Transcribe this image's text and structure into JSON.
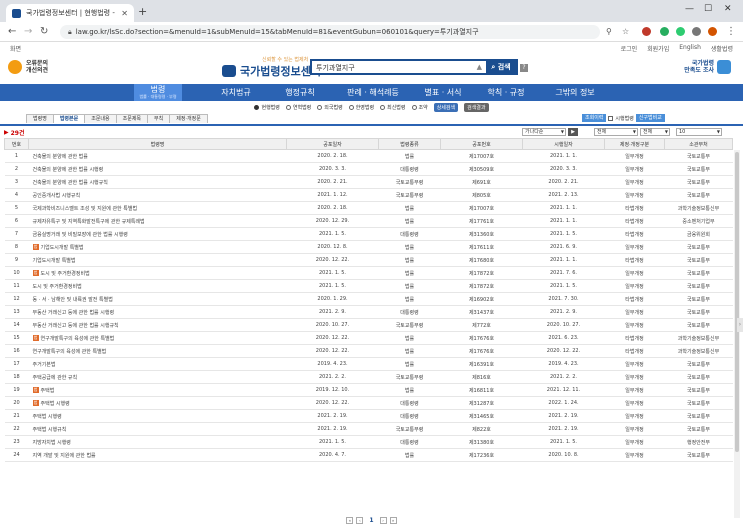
{
  "browser": {
    "tab_title": "국가법령정보센터 | 현행법령 -",
    "url": "law.go.kr/lsSc.do?section=&menuId=1&subMenuId=15&tabMenuId=81&eventGubun=060101&query=투기과열지구"
  },
  "util": {
    "left": "화면",
    "links": [
      "로그인",
      "회원가입",
      "English",
      "생활법령"
    ]
  },
  "header": {
    "left_logo": [
      "오류문의",
      "개선의견"
    ],
    "slogan": "신뢰할 수 있는 법제처",
    "brand": "국가법령정보센터",
    "search_query": "투기과열지구",
    "search_button": "검색",
    "right_logo": [
      "국가법령",
      "만족도 조사"
    ]
  },
  "menu": {
    "active_label": "법령",
    "active_sub": "법률 · 대통령령 · 부령",
    "items": [
      "자치법규",
      "행정규칙",
      "판례 · 해석례등",
      "별표 · 서식",
      "학칙 · 규정",
      "그밖의 정보"
    ]
  },
  "options": {
    "radios": [
      "현행법령",
      "연혁법령",
      "외국법령",
      "한영법령",
      "최신법령",
      "조약"
    ],
    "buttons": [
      "상세검색",
      "검색결과"
    ]
  },
  "subtabs": [
    "법령명",
    "법령본문",
    "조문내용",
    "조문제목",
    "부칙",
    "제정·개정문"
  ],
  "tools": {
    "buttons": [
      "조회이력",
      "신구법비교"
    ],
    "checkbox": "시행법령"
  },
  "results": {
    "count": "29건",
    "selects": [
      "가나다순",
      "전체",
      "전체",
      "10"
    ]
  },
  "table": {
    "headers": [
      "번호",
      "법령명",
      "공포일자",
      "법령종류",
      "공포번호",
      "시행일자",
      "제정·개정구분",
      "소관부처"
    ],
    "rows": [
      {
        "no": "1",
        "name": "건축물의 분양에 관한 법률",
        "tag": "",
        "date": "2020. 2. 18.",
        "kind": "법률",
        "num": "제17007호",
        "eff": "2021. 1. 1.",
        "type": "일부개정",
        "dept": "국토교통부"
      },
      {
        "no": "2",
        "name": "건축물의 분양에 관한 법률 시행령",
        "tag": "",
        "date": "2020. 3. 3.",
        "kind": "대통령령",
        "num": "제30509호",
        "eff": "2020. 3. 3.",
        "type": "일부개정",
        "dept": "국토교통부"
      },
      {
        "no": "3",
        "name": "건축물의 분양에 관한 법률 시행규칙",
        "tag": "",
        "date": "2020. 2. 21.",
        "kind": "국토교통부령",
        "num": "제691호",
        "eff": "2020. 2. 21.",
        "type": "일부개정",
        "dept": "국토교통부"
      },
      {
        "no": "4",
        "name": "공인중개사법 시행규칙",
        "tag": "",
        "date": "2021. 1. 12.",
        "kind": "국토교통부령",
        "num": "제805호",
        "eff": "2021. 2. 13.",
        "type": "일부개정",
        "dept": "국토교통부"
      },
      {
        "no": "5",
        "name": "국제과학비즈니스벨트 조성 및 지원에 관한 특별법",
        "tag": "",
        "date": "2020. 2. 18.",
        "kind": "법률",
        "num": "제17007호",
        "eff": "2021. 1. 1.",
        "type": "타법개정",
        "dept": "과학기술정보통신부"
      },
      {
        "no": "6",
        "name": "규제자유특구 및 지역특화발전특구에 관한 규제특례법",
        "tag": "",
        "date": "2020. 12. 29.",
        "kind": "법률",
        "num": "제17761호",
        "eff": "2021. 1. 1.",
        "type": "타법개정",
        "dept": "중소벤처기업부"
      },
      {
        "no": "7",
        "name": "금융실명거래 및 비밀보장에 관한 법률 시행령",
        "tag": "",
        "date": "2021. 1. 5.",
        "kind": "대통령령",
        "num": "제31360호",
        "eff": "2021. 1. 5.",
        "type": "타법개정",
        "dept": "금융위원회"
      },
      {
        "no": "8",
        "name": "기업도시개발 특별법",
        "tag": "법",
        "date": "2020. 12. 8.",
        "kind": "법률",
        "num": "제17611호",
        "eff": "2021. 6. 9.",
        "type": "일부개정",
        "dept": "국토교통부"
      },
      {
        "no": "9",
        "name": "기업도시개발 특별법",
        "tag": "",
        "date": "2020. 12. 22.",
        "kind": "법률",
        "num": "제17680호",
        "eff": "2021. 1. 1.",
        "type": "타법개정",
        "dept": "국토교통부"
      },
      {
        "no": "10",
        "name": "도시 및 주거환경정비법",
        "tag": "법",
        "date": "2021. 1. 5.",
        "kind": "법률",
        "num": "제17872호",
        "eff": "2021. 7. 6.",
        "type": "일부개정",
        "dept": "국토교통부"
      },
      {
        "no": "11",
        "name": "도시 및 주거환경정비법",
        "tag": "",
        "date": "2021. 1. 5.",
        "kind": "법률",
        "num": "제17872호",
        "eff": "2021. 1. 5.",
        "type": "일부개정",
        "dept": "국토교통부"
      },
      {
        "no": "12",
        "name": "동 · 서 · 남해안 및 내륙권 발전 특별법",
        "tag": "",
        "date": "2020. 1. 29.",
        "kind": "법률",
        "num": "제16902호",
        "eff": "2021. 7. 30.",
        "type": "타법개정",
        "dept": "국토교통부"
      },
      {
        "no": "13",
        "name": "부동산 거래신고 등에 관한 법률 시행령",
        "tag": "",
        "date": "2021. 2. 9.",
        "kind": "대통령령",
        "num": "제31437호",
        "eff": "2021. 2. 9.",
        "type": "일부개정",
        "dept": "국토교통부"
      },
      {
        "no": "14",
        "name": "부동산 거래신고 등에 관한 법률 시행규칙",
        "tag": "",
        "date": "2020. 10. 27.",
        "kind": "국토교통부령",
        "num": "제772호",
        "eff": "2020. 10. 27.",
        "type": "일부개정",
        "dept": "국토교통부"
      },
      {
        "no": "15",
        "name": "연구개발특구의 육성에 관한 특별법",
        "tag": "법",
        "date": "2020. 12. 22.",
        "kind": "법률",
        "num": "제17676호",
        "eff": "2021. 6. 23.",
        "type": "타법개정",
        "dept": "과학기술정보통신부"
      },
      {
        "no": "16",
        "name": "연구개발특구의 육성에 관한 특별법",
        "tag": "",
        "date": "2020. 12. 22.",
        "kind": "법률",
        "num": "제17676호",
        "eff": "2020. 12. 22.",
        "type": "타법개정",
        "dept": "과학기술정보통신부"
      },
      {
        "no": "17",
        "name": "주거기본법",
        "tag": "",
        "date": "2019. 4. 23.",
        "kind": "법률",
        "num": "제16391호",
        "eff": "2019. 4. 23.",
        "type": "일부개정",
        "dept": "국토교통부"
      },
      {
        "no": "18",
        "name": "주택공급에 관한 규칙",
        "tag": "",
        "date": "2021. 2. 2.",
        "kind": "국토교통부령",
        "num": "제816호",
        "eff": "2021. 2. 2.",
        "type": "일부개정",
        "dept": "국토교통부"
      },
      {
        "no": "19",
        "name": "주택법",
        "tag": "법",
        "date": "2019. 12. 10.",
        "kind": "법률",
        "num": "제16811호",
        "eff": "2021. 12. 11.",
        "type": "일부개정",
        "dept": "국토교통부"
      },
      {
        "no": "20",
        "name": "주택법 시행령",
        "tag": "법",
        "date": "2020. 12. 22.",
        "kind": "대통령령",
        "num": "제31287호",
        "eff": "2022. 1. 24.",
        "type": "일부개정",
        "dept": "국토교통부"
      },
      {
        "no": "21",
        "name": "주택법 시행령",
        "tag": "",
        "date": "2021. 2. 19.",
        "kind": "대통령령",
        "num": "제31465호",
        "eff": "2021. 2. 19.",
        "type": "일부개정",
        "dept": "국토교통부"
      },
      {
        "no": "22",
        "name": "주택법 시행규칙",
        "tag": "",
        "date": "2021. 2. 19.",
        "kind": "국토교통부령",
        "num": "제822호",
        "eff": "2021. 2. 19.",
        "type": "일부개정",
        "dept": "국토교통부"
      },
      {
        "no": "23",
        "name": "지방자치법 시행령",
        "tag": "",
        "date": "2021. 1. 5.",
        "kind": "대통령령",
        "num": "제31380호",
        "eff": "2021. 1. 5.",
        "type": "일부개정",
        "dept": "행정안전부"
      },
      {
        "no": "24",
        "name": "지역 개발 및 지원에 관한 법률",
        "tag": "",
        "date": "2020. 4. 7.",
        "kind": "법률",
        "num": "제17236호",
        "eff": "2020. 10. 8.",
        "type": "일부개정",
        "dept": "국토교통부"
      }
    ]
  },
  "pager": {
    "current": "1"
  },
  "colors": {
    "brand": "#1a4d8f",
    "menu": "#2b63b3",
    "tag": "#e06b2b"
  }
}
